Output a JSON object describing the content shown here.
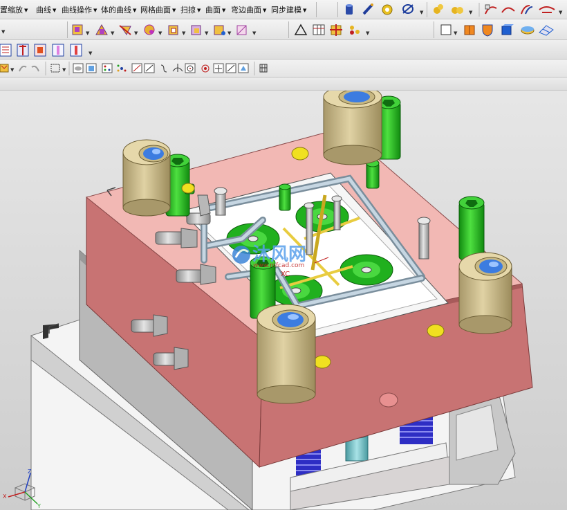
{
  "menubar": {
    "items": [
      {
        "label": "视图缩放",
        "partial": "置缩放"
      },
      {
        "label": "曲线"
      },
      {
        "label": "曲线操作"
      },
      {
        "label": "体的曲线"
      },
      {
        "label": "网格曲面"
      },
      {
        "label": "扫掠"
      },
      {
        "label": "曲面"
      },
      {
        "label": "弯边曲面"
      },
      {
        "label": "同步建模"
      }
    ]
  },
  "watermark": {
    "brand": "沐风网",
    "url": "www.mfcad.com"
  },
  "viewport": {
    "wcs_label": "XC"
  },
  "colors": {
    "mold_top_face": "#f2b8b4",
    "mold_side_face": "#c87373",
    "bushing": "#c9b88a",
    "bushing_hole": "#3c7ce0",
    "screw_green": "#25c21f",
    "cooling_pipe": "#9fb4c4",
    "base_plate": "#d9d9d9",
    "spring_blue": "#3030c8"
  },
  "icons": [
    "cylinder-icon",
    "line-tool-icon",
    "rotate-icon",
    "globe-icon",
    "gear-group-icon",
    "gear-double-icon",
    "curve-edit-icon",
    "curve-bridge-icon",
    "curve-offset-icon",
    "block-icon",
    "pyramid-icon",
    "cone-icon",
    "sphere-icon",
    "cube-edit-icon",
    "cube-add-icon",
    "cube-move-icon",
    "cube-section-icon",
    "triangle-icon",
    "grid-table-icon",
    "plus-grid-icon",
    "node-icon",
    "plane-icon",
    "box-orange-icon",
    "shield-icon",
    "cube-blue-icon",
    "disk-icon",
    "mesh-icon"
  ]
}
